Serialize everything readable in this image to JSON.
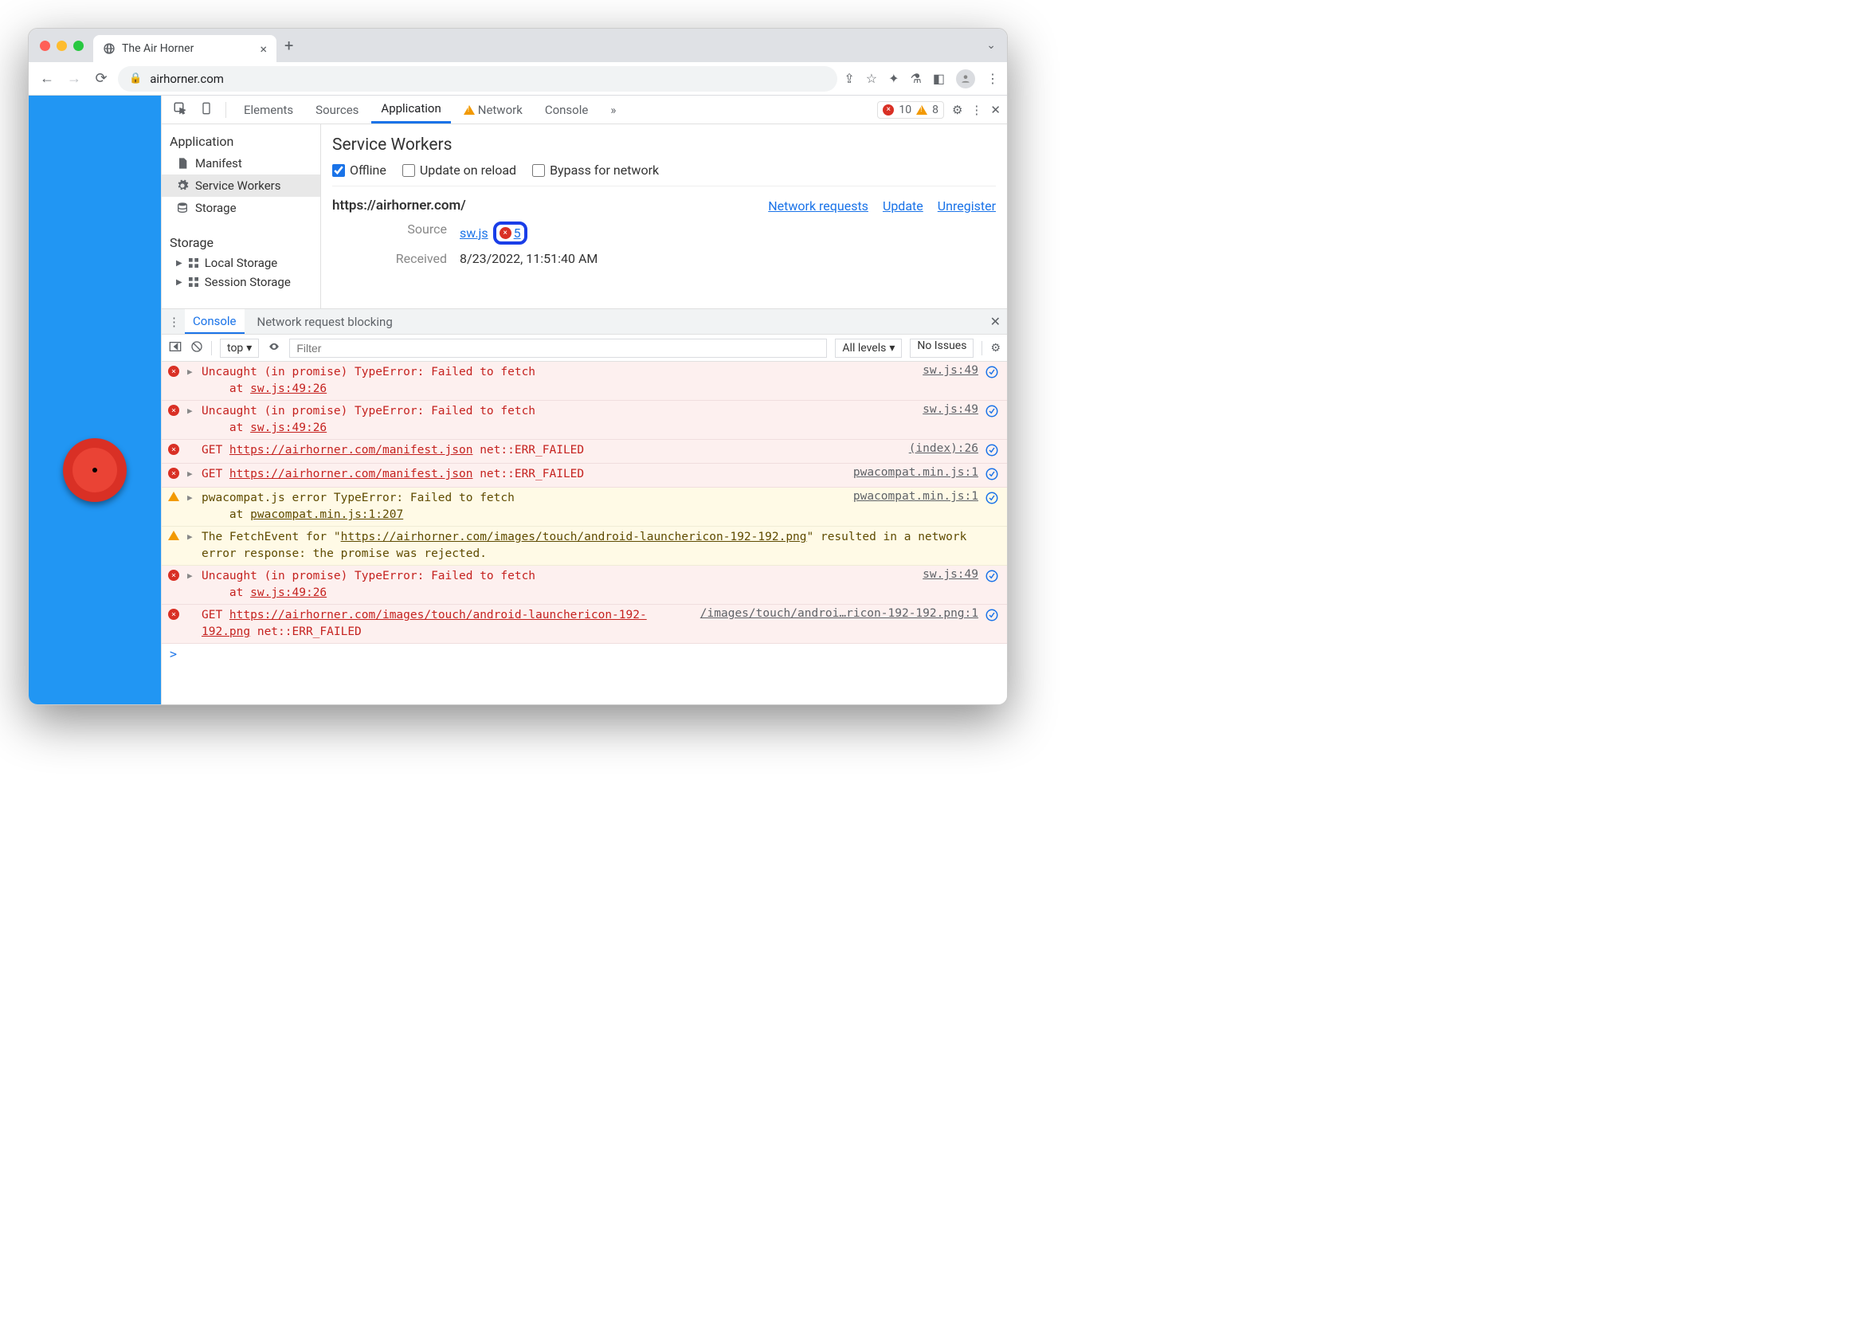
{
  "chrome": {
    "tab_title": "The Air Horner",
    "url": "airhorner.com"
  },
  "devtools": {
    "tabs": [
      "Elements",
      "Sources",
      "Application",
      "Network",
      "Console"
    ],
    "active_tab": "Application",
    "more": "»",
    "error_count": "10",
    "warn_count": "8"
  },
  "app_sidebar": {
    "section1": "Application",
    "items1": [
      "Manifest",
      "Service Workers",
      "Storage"
    ],
    "section2": "Storage",
    "items2": [
      "Local Storage",
      "Session Storage"
    ]
  },
  "app_main": {
    "title": "Service Workers",
    "checks": {
      "offline": "Offline",
      "update": "Update on reload",
      "bypass": "Bypass for network"
    },
    "origin": "https://airhorner.com/",
    "links": {
      "net": "Network requests",
      "update": "Update",
      "unreg": "Unregister"
    },
    "source_label": "Source",
    "source_file": "sw.js",
    "source_err_count": "5",
    "received_label": "Received",
    "received_value": "8/23/2022, 11:51:40 AM"
  },
  "drawer": {
    "tabs": [
      "Console",
      "Network request blocking"
    ],
    "context": "top",
    "levels": "All levels",
    "issues": "No Issues",
    "filter_placeholder": "Filter"
  },
  "console_rows": [
    {
      "type": "err",
      "disc": true,
      "msg": "Uncaught (in promise) TypeError: Failed to fetch\n    at ",
      "link": "sw.js:49:26",
      "src": "sw.js:49"
    },
    {
      "type": "err",
      "disc": true,
      "msg": "Uncaught (in promise) TypeError: Failed to fetch\n    at ",
      "link": "sw.js:49:26",
      "src": "sw.js:49"
    },
    {
      "type": "err",
      "disc": false,
      "prefix": "GET ",
      "url": "https://airhorner.com/manifest.json",
      "suffix": " net::ERR_FAILED",
      "src": "(index):26"
    },
    {
      "type": "err",
      "disc": true,
      "prefix": "GET ",
      "url": "https://airhorner.com/manifest.json",
      "suffix": " net::ERR_FAILED",
      "src": "pwacompat.min.js:1"
    },
    {
      "type": "warn",
      "disc": true,
      "msg": "pwacompat.js error TypeError: Failed to fetch\n    at ",
      "link": "pwacompat.min.js:1:207",
      "src": "pwacompat.min.js:1"
    },
    {
      "type": "warn",
      "disc": true,
      "plain": "The FetchEvent for \"",
      "url": "https://airhorner.com/images/touch/android-launchericon-192-192.png",
      "plain2": "\" resulted in a network error response: the promise was rejected.",
      "src": ""
    },
    {
      "type": "err",
      "disc": true,
      "msg": "Uncaught (in promise) TypeError: Failed to fetch\n    at ",
      "link": "sw.js:49:26",
      "src": "sw.js:49"
    },
    {
      "type": "err",
      "disc": false,
      "prefix": "GET ",
      "url": "https://airhorner.com/images/touch/android-launchericon-192-192.png",
      "suffix": " net::ERR_FAILED",
      "src": "/images/touch/androi…ricon-192-192.png:1"
    }
  ],
  "prompt": ">"
}
